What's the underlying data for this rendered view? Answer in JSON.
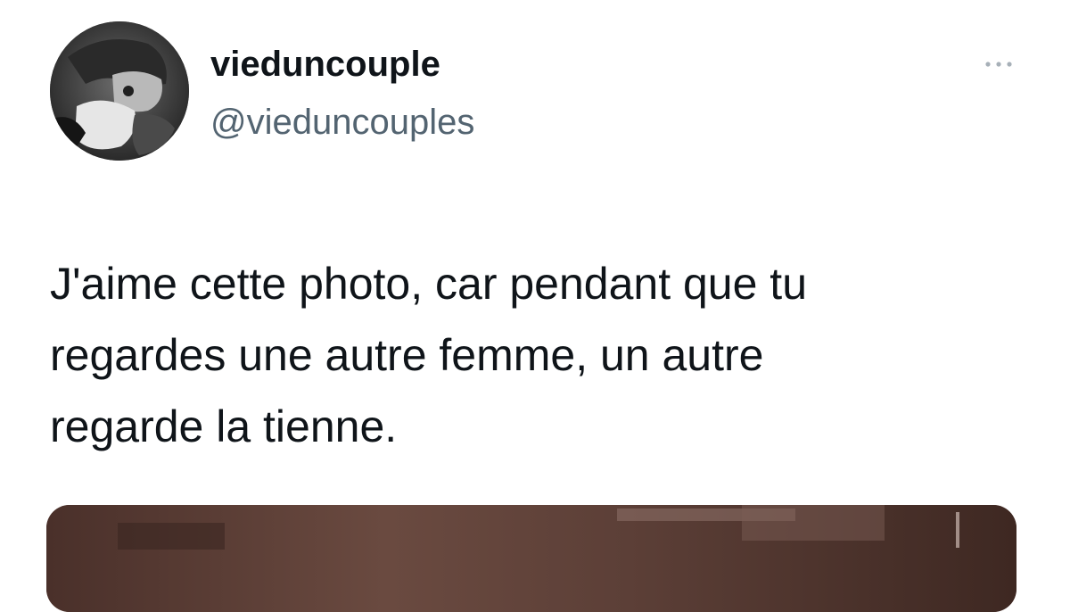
{
  "tweet": {
    "author": {
      "display_name": "vieduncouple",
      "handle": "@vieduncouples",
      "avatar_icon": "black-and-white-couple-photo"
    },
    "more_icon": "more-options-ellipsis-icon",
    "text": "J'aime cette photo, car pendant que tu\nregardes une autre femme, un autre\nregarde la tienne.",
    "media": {
      "kind": "photo",
      "dominant_color": "#5a3c34"
    }
  },
  "colors": {
    "text_primary": "#0f1419",
    "text_secondary": "#536471",
    "background": "#ffffff"
  }
}
